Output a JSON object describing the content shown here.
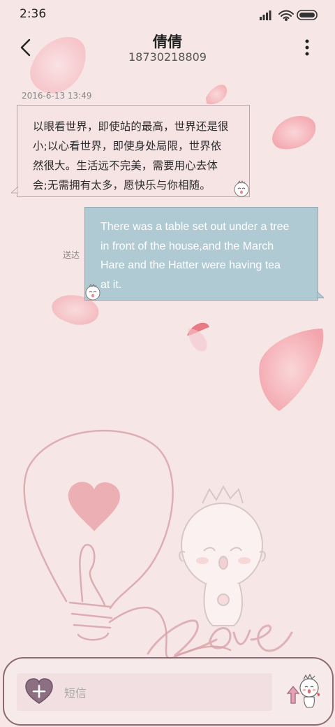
{
  "status_bar": {
    "time": "2:36",
    "icons": [
      "signal-icon",
      "wifi-icon",
      "battery-icon"
    ]
  },
  "header": {
    "contact_name": "倩倩",
    "contact_number": "18730218809",
    "back_icon": "chevron-left-icon",
    "menu_icon": "more-vertical-icon"
  },
  "conversation": {
    "timestamp": "2016-6-13 13:49",
    "messages": [
      {
        "direction": "incoming",
        "lines": [
          "以眼看世界，即使站的最高，世界还是很",
          "小;以心看世界，即使身处局限，世界依",
          "然很大。生活远不完美，需要用心去体",
          "会;无需拥有太多，愿快乐与你相随。"
        ]
      },
      {
        "direction": "outgoing",
        "status": "送达",
        "lines": [
          "There was a table set out under a tree",
          "in front of the house,and the March",
          "Hare and the Hatter were having tea",
          "at it."
        ]
      }
    ]
  },
  "composer": {
    "placeholder": "短信",
    "attach_icon": "heart-plus-icon",
    "send_icon": "send-arrow-icon"
  },
  "colors": {
    "background": "#f6e6e5",
    "incoming_bubble": "#f6e2e4",
    "outgoing_bubble": "#acc8d2",
    "accent": "#8c6a72",
    "petal": "#f3a8ae"
  }
}
